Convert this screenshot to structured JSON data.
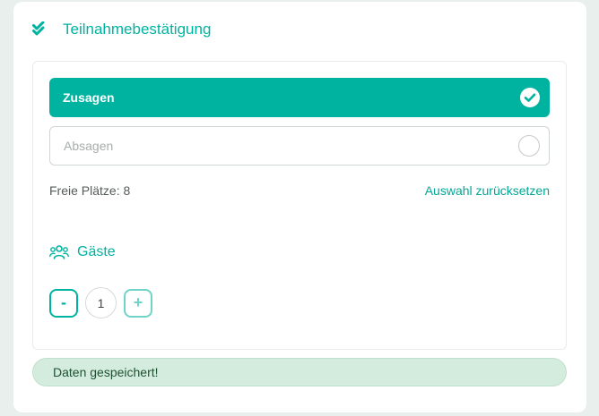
{
  "header": {
    "title": "Teilnahmebestätigung",
    "icon": "double-check-icon"
  },
  "options": {
    "accept_label": "Zusagen",
    "accept_selected": true,
    "decline_label": "Absagen",
    "decline_selected": false
  },
  "free_places_text": "Freie Plätze: 8",
  "reset_label": "Auswahl zurücksetzen",
  "guests": {
    "title": "Gäste",
    "icon": "users-icon",
    "decrement_label": "-",
    "count": "1",
    "increment_label": "+"
  },
  "status": {
    "message": "Daten gespeichert!"
  },
  "colors": {
    "accent": "#00b3a1",
    "success_bg": "#d4ecdd",
    "success_text": "#1f5133"
  }
}
